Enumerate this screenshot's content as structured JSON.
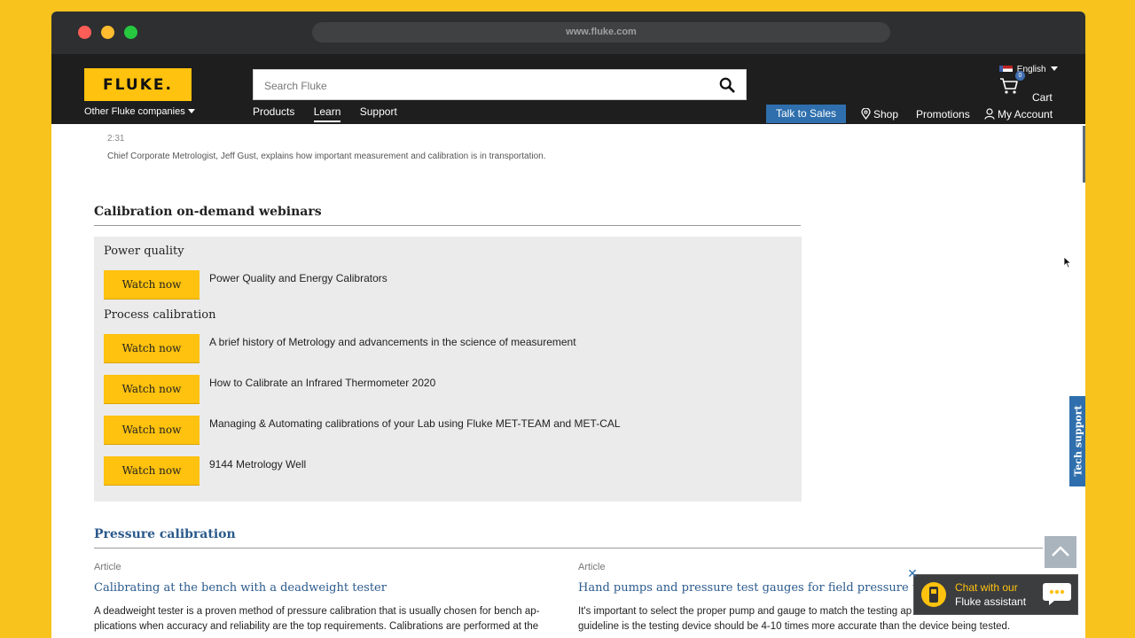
{
  "browser": {
    "url": "www.fluke.com"
  },
  "header": {
    "logo_text": "FLUKE.",
    "other_companies": "Other Fluke companies",
    "search_placeholder": "Search Fluke",
    "language": "English",
    "cart_count": "0",
    "cart_label": "Cart",
    "nav": [
      "Products",
      "Learn",
      "Support"
    ],
    "talk_to_sales": "Talk to Sales",
    "shop": "Shop",
    "promotions": "Promotions",
    "my_account": "My Account"
  },
  "video": {
    "duration": "2:31",
    "description": "Chief Corporate Metrologist, Jeff Gust, explains how important measurement and calibration is in transportation."
  },
  "webinars": {
    "title": "Calibration on-demand webinars",
    "watch_label": "Watch now",
    "groups": [
      {
        "title": "Power quality",
        "items": [
          "Power Quality and Energy Calibrators"
        ]
      },
      {
        "title": "Process calibration",
        "items": [
          "A brief history of Metrology and advancements in the science of measurement",
          "How to Calibrate an Infrared Thermometer 2020",
          "Managing & Automating calibrations of your Lab using Fluke MET-TEAM and MET-CAL",
          "9144 Metrology Well"
        ]
      }
    ]
  },
  "pressure": {
    "title": "Pressure calibration",
    "articles": [
      {
        "type": "Article",
        "title": "Calibrating at the bench with a deadweight tester",
        "text_line1": "A deadweight tester is a proven method of pressure calibration that is usually chosen for bench ap-",
        "text_line2": "plications when accuracy and reliability are the top requirements. Calibrations are performed at the"
      },
      {
        "type": "Article",
        "title": "Hand pumps and pressure test gauges for field pressure test...",
        "text_line1": "It's important to select the proper pump and gauge to match the testing ap",
        "text_line2": "guideline is the testing device should be 4-10 times more accurate than the device being tested."
      }
    ]
  },
  "side": {
    "tech_support": "Tech support",
    "chat_line1": "Chat with our",
    "chat_line2": "Fluke assistant",
    "chat_close": "✕"
  },
  "colors": {
    "brand_yellow": "#ffc20e",
    "link_blue": "#2b5a8c",
    "accent_blue": "#2f6fad"
  }
}
